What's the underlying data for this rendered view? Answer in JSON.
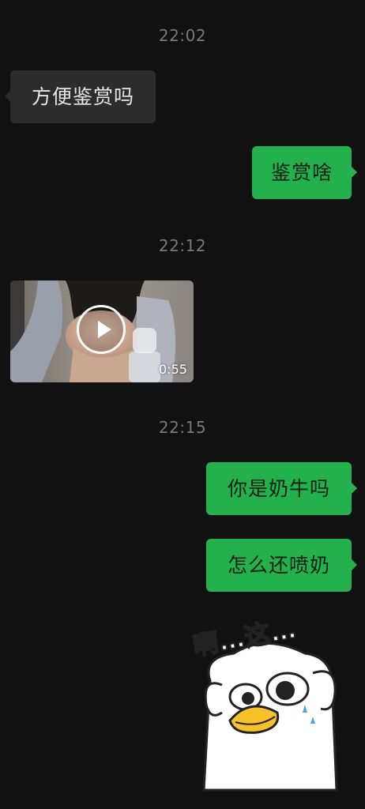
{
  "messages": [
    {
      "timestamp": "22:02"
    },
    {
      "incoming_text": "方便鉴赏吗"
    },
    {
      "outgoing_text": "鉴赏啥"
    },
    {
      "timestamp": "22:12"
    },
    {
      "video_duration": "0:55"
    },
    {
      "timestamp": "22:15"
    },
    {
      "outgoing_text": "你是奶牛吗"
    },
    {
      "outgoing_text": "怎么还喷奶"
    },
    {
      "sticker_text": "啊…这…"
    }
  ],
  "colors": {
    "background": "#111111",
    "incoming_bubble": "#2c2c2c",
    "outgoing_bubble": "#22b14c",
    "timestamp": "#7a7a7a"
  },
  "icons": {
    "play": "play-icon",
    "sticker": "duck-sticker-icon"
  }
}
